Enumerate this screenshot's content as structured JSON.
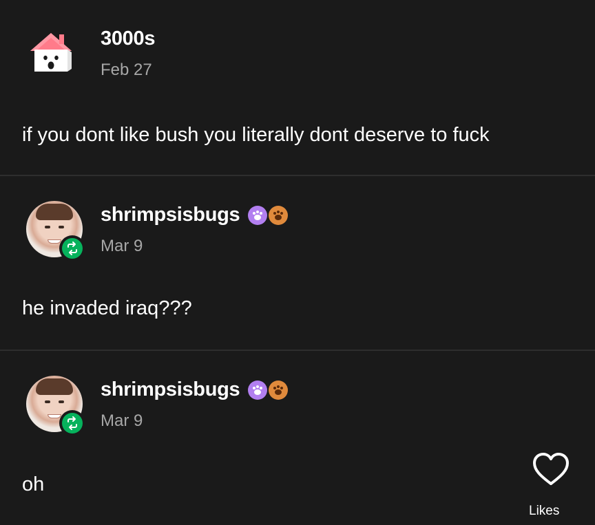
{
  "posts": [
    {
      "username": "3000s",
      "date": "Feb 27",
      "text": "if you dont like bush you literally dont deserve to fuck",
      "avatar_icon": "house-icon"
    },
    {
      "username": "shrimpsisbugs",
      "date": "Mar 9",
      "text": "he invaded iraq???",
      "avatar_icon": "person-avatar",
      "badge_icons": [
        "purple-paw-badge-icon",
        "orange-paw-badge-icon"
      ],
      "reblog_icon": "reblog-icon"
    },
    {
      "username": "shrimpsisbugs",
      "date": "Mar 9",
      "text": "oh",
      "avatar_icon": "person-avatar",
      "badge_icons": [
        "purple-paw-badge-icon",
        "orange-paw-badge-icon"
      ],
      "reblog_icon": "reblog-icon"
    }
  ],
  "actions": {
    "like_icon": "heart-icon",
    "likes_label": "Likes"
  },
  "colors": {
    "background": "#1a1a1a",
    "divider": "#2e2e2e",
    "reblog_green": "#06b25c",
    "date_gray": "#a7a7a7",
    "badge_purple": "#b27ff0",
    "badge_orange": "#e08a3c"
  }
}
